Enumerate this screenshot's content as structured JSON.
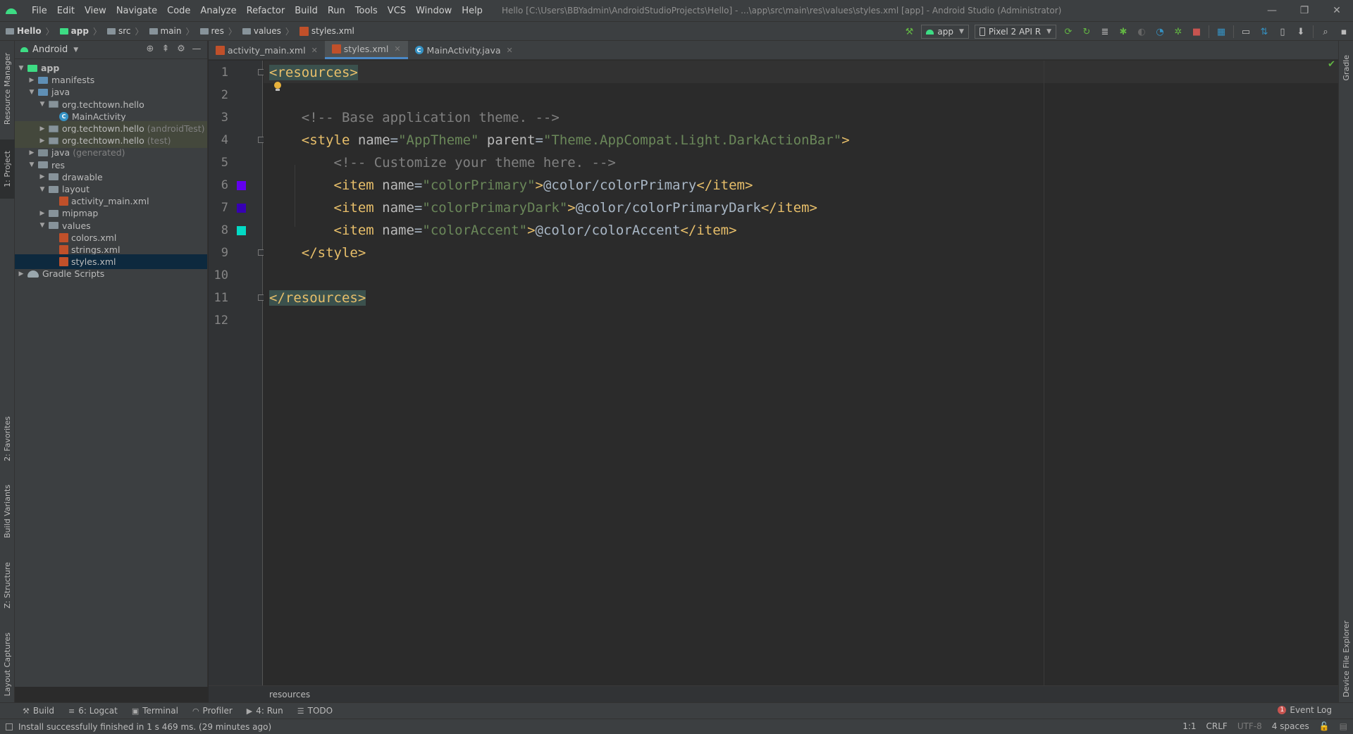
{
  "menu": {
    "items": [
      "File",
      "Edit",
      "View",
      "Navigate",
      "Code",
      "Analyze",
      "Refactor",
      "Build",
      "Run",
      "Tools",
      "VCS",
      "Window",
      "Help"
    ],
    "window_title": "Hello [C:\\Users\\BBYadmin\\AndroidStudioProjects\\Hello] - ...\\app\\src\\main\\res\\values\\styles.xml [app] - Android Studio (Administrator)"
  },
  "window_controls": {
    "minimize": "—",
    "restore": "❐",
    "close": "✕"
  },
  "breadcrumb": [
    "Hello",
    "app",
    "src",
    "main",
    "res",
    "values",
    "styles.xml"
  ],
  "toolbar": {
    "run_config": "app",
    "device": "Pixel 2 API R"
  },
  "project_panel": {
    "view": "Android",
    "tree": [
      {
        "label": "app",
        "depth": 0,
        "expanded": true,
        "icon": "module"
      },
      {
        "label": "manifests",
        "depth": 1,
        "expanded": false,
        "icon": "folder-blue"
      },
      {
        "label": "java",
        "depth": 1,
        "expanded": true,
        "icon": "folder-blue"
      },
      {
        "label": "org.techtown.hello",
        "depth": 2,
        "expanded": true,
        "icon": "package"
      },
      {
        "label": "MainActivity",
        "depth": 3,
        "icon": "class"
      },
      {
        "label": "org.techtown.hello",
        "suffix": "(androidTest)",
        "depth": 2,
        "expanded": false,
        "icon": "package",
        "test": true
      },
      {
        "label": "org.techtown.hello",
        "suffix": "(test)",
        "depth": 2,
        "expanded": false,
        "icon": "package",
        "test": true
      },
      {
        "label": "java",
        "suffix": "(generated)",
        "depth": 1,
        "expanded": false,
        "icon": "folder-gen"
      },
      {
        "label": "res",
        "depth": 1,
        "expanded": true,
        "icon": "folder-res"
      },
      {
        "label": "drawable",
        "depth": 2,
        "expanded": false,
        "icon": "folder"
      },
      {
        "label": "layout",
        "depth": 2,
        "expanded": true,
        "icon": "folder"
      },
      {
        "label": "activity_main.xml",
        "depth": 3,
        "icon": "xml"
      },
      {
        "label": "mipmap",
        "depth": 2,
        "expanded": false,
        "icon": "folder"
      },
      {
        "label": "values",
        "depth": 2,
        "expanded": true,
        "icon": "folder"
      },
      {
        "label": "colors.xml",
        "depth": 3,
        "icon": "xml"
      },
      {
        "label": "strings.xml",
        "depth": 3,
        "icon": "xml"
      },
      {
        "label": "styles.xml",
        "depth": 3,
        "icon": "xml",
        "selected": true
      },
      {
        "label": "Gradle Scripts",
        "depth": 0,
        "expanded": false,
        "icon": "gradle"
      }
    ]
  },
  "editor_tabs": [
    {
      "label": "activity_main.xml",
      "icon": "xml",
      "active": false
    },
    {
      "label": "styles.xml",
      "icon": "xml",
      "active": true
    },
    {
      "label": "MainActivity.java",
      "icon": "class",
      "active": false
    }
  ],
  "code": {
    "line_numbers": [
      "1",
      "2",
      "3",
      "4",
      "5",
      "6",
      "7",
      "8",
      "9",
      "10",
      "11",
      "12"
    ],
    "lines": [
      [
        {
          "t": "<resources>",
          "c": "tag hl"
        }
      ],
      [],
      [
        {
          "t": "    <!-- Base application theme. -->",
          "c": "cmt"
        }
      ],
      [
        {
          "t": "    <style ",
          "c": "tag"
        },
        {
          "t": "name",
          "c": "attr"
        },
        {
          "t": "=",
          "c": "txt"
        },
        {
          "t": "\"AppTheme\"",
          "c": "val"
        },
        {
          "t": " parent",
          "c": "attr"
        },
        {
          "t": "=",
          "c": "txt"
        },
        {
          "t": "\"Theme.AppCompat.Light.DarkActionBar\"",
          "c": "val"
        },
        {
          "t": ">",
          "c": "tag"
        }
      ],
      [
        {
          "t": "        <!-- Customize your theme here. -->",
          "c": "cmt"
        }
      ],
      [
        {
          "t": "        <item ",
          "c": "tag"
        },
        {
          "t": "name",
          "c": "attr"
        },
        {
          "t": "=",
          "c": "txt"
        },
        {
          "t": "\"colorPrimary\"",
          "c": "val"
        },
        {
          "t": ">",
          "c": "tag"
        },
        {
          "t": "@color/colorPrimary",
          "c": "txt"
        },
        {
          "t": "</item>",
          "c": "tag"
        }
      ],
      [
        {
          "t": "        <item ",
          "c": "tag"
        },
        {
          "t": "name",
          "c": "attr"
        },
        {
          "t": "=",
          "c": "txt"
        },
        {
          "t": "\"colorPrimaryDark\"",
          "c": "val"
        },
        {
          "t": ">",
          "c": "tag"
        },
        {
          "t": "@color/colorPrimaryDark",
          "c": "txt"
        },
        {
          "t": "</item>",
          "c": "tag"
        }
      ],
      [
        {
          "t": "        <item ",
          "c": "tag"
        },
        {
          "t": "name",
          "c": "attr"
        },
        {
          "t": "=",
          "c": "txt"
        },
        {
          "t": "\"colorAccent\"",
          "c": "val"
        },
        {
          "t": ">",
          "c": "tag"
        },
        {
          "t": "@color/colorAccent",
          "c": "txt"
        },
        {
          "t": "</item>",
          "c": "tag"
        }
      ],
      [
        {
          "t": "    </style>",
          "c": "tag"
        }
      ],
      [],
      [
        {
          "t": "</resources>",
          "c": "tag hl"
        }
      ],
      []
    ],
    "color_swatches": [
      {
        "line": 6,
        "color": "#6200ee"
      },
      {
        "line": 7,
        "color": "#3700b3"
      },
      {
        "line": 8,
        "color": "#03dac5"
      }
    ]
  },
  "editor_breadcrumb": "resources",
  "left_tool_tabs": [
    "Resource Manager",
    "1: Project",
    "2: Favorites",
    "Build Variants",
    "Z: Structure",
    "Layout Captures"
  ],
  "right_tool_tabs": [
    "Gradle",
    "Device File Explorer"
  ],
  "bottom_tabs": [
    {
      "label": "Build",
      "icon": "hammer-icon"
    },
    {
      "label": "6: Logcat",
      "icon": "logcat-icon"
    },
    {
      "label": "Terminal",
      "icon": "terminal-icon"
    },
    {
      "label": "Profiler",
      "icon": "profiler-icon"
    },
    {
      "label": "4: Run",
      "icon": "run-icon"
    },
    {
      "label": "TODO",
      "icon": "todo-icon"
    }
  ],
  "event_log": {
    "label": "Event Log",
    "count": "1"
  },
  "status": {
    "message": "Install successfully finished in 1 s 469 ms. (29 minutes ago)",
    "position": "1:1",
    "line_separator": "CRLF",
    "encoding": "UTF-8",
    "indent": "4 spaces"
  },
  "colors": {
    "accent_blue": "#4a88c7",
    "tag": "#e8bf6a",
    "string": "#6a8759",
    "comment": "#808080",
    "android_green": "#3ddc84"
  }
}
